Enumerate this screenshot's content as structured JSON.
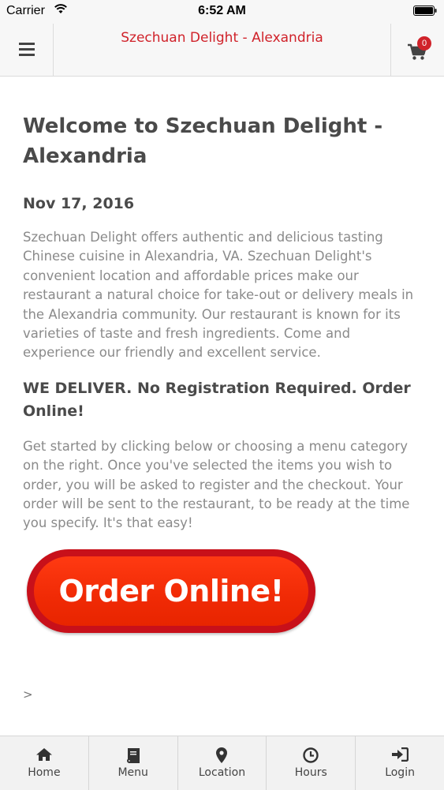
{
  "status_bar": {
    "carrier": "Carrier",
    "time": "6:52 AM",
    "wifi_icon": "wifi-icon",
    "battery_icon": "battery-icon"
  },
  "header": {
    "title": "Szechuan Delight - Alexandria",
    "menu_icon": "hamburger-menu-icon",
    "cart_icon": "cart-icon",
    "cart_count": "0",
    "accent_color": "#d0222a"
  },
  "main": {
    "title": "Welcome to Szechuan Delight - Alexandria",
    "date": "Nov 17, 2016",
    "intro": "Szechuan Delight offers authentic and delicious tasting Chinese cuisine in Alexandria, VA. Szechuan Delight's convenient location and affordable prices make our restaurant a natural choice for take-out or delivery meals in the Alexandria community. Our restaurant is known for its varieties of taste and fresh ingredients. Come and experience our friendly and excellent service.",
    "subheading": "WE DELIVER. No Registration Required. Order Online!",
    "instructions": "Get started by clicking below or choosing a menu category on the right. Once you've selected the items you wish to order, you will be asked to register and the checkout. Your order will be sent to the restaurant, to be ready at the time you specify. It's that easy!",
    "order_button": "Order Online!",
    "chevron": ">"
  },
  "tabbar": {
    "items": [
      {
        "label": "Home",
        "icon": "home-icon"
      },
      {
        "label": "Menu",
        "icon": "book-icon"
      },
      {
        "label": "Location",
        "icon": "map-pin-icon"
      },
      {
        "label": "Hours",
        "icon": "clock-icon"
      },
      {
        "label": "Login",
        "icon": "sign-in-icon"
      }
    ]
  }
}
